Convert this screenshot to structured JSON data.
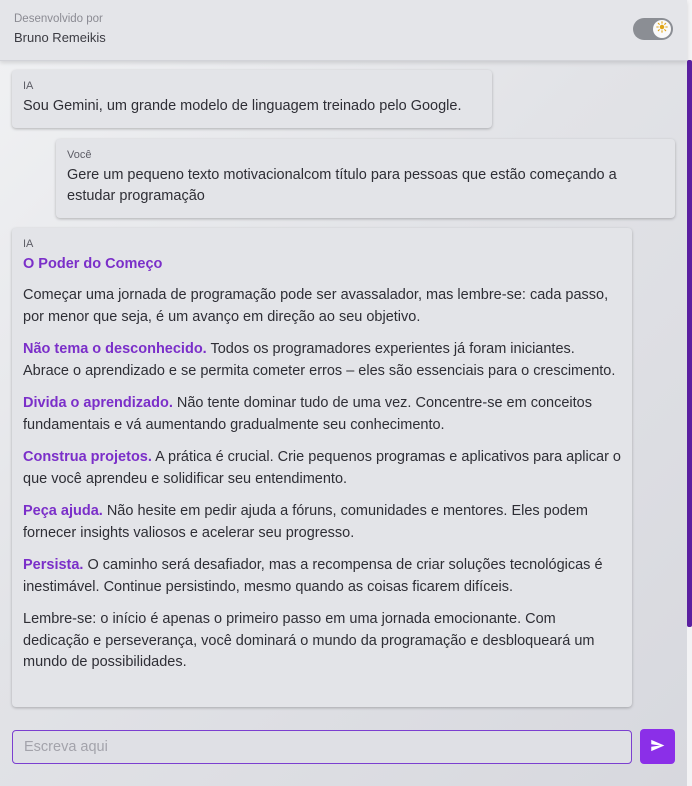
{
  "header": {
    "caption": "Desenvolvido por",
    "author": "Bruno Remeikis",
    "theme_toggle_icon": "sun-icon"
  },
  "messages": [
    {
      "sender": "IA",
      "text": "Sou Gemini, um grande modelo de linguagem treinado pelo Google."
    },
    {
      "sender": "Você",
      "text": "Gere um pequeno texto motivacionalcom título para pessoas que estão começando a estudar programação"
    },
    {
      "sender": "IA",
      "title": "O Poder do Começo",
      "paragraphs": [
        {
          "highlight": "",
          "text": "Começar uma jornada de programação pode ser avassalador, mas lembre-se: cada passo, por menor que seja, é um avanço em direção ao seu objetivo."
        },
        {
          "highlight": "Não tema o desconhecido.",
          "text": " Todos os programadores experientes já foram iniciantes. Abrace o aprendizado e se permita cometer erros – eles são essenciais para o crescimento."
        },
        {
          "highlight": "Divida o aprendizado.",
          "text": " Não tente dominar tudo de uma vez. Concentre-se em conceitos fundamentais e vá aumentando gradualmente seu conhecimento."
        },
        {
          "highlight": "Construa projetos.",
          "text": " A prática é crucial. Crie pequenos programas e aplicativos para aplicar o que você aprendeu e solidificar seu entendimento."
        },
        {
          "highlight": "Peça ajuda.",
          "text": " Não hesite em pedir ajuda a fóruns, comunidades e mentores. Eles podem fornecer insights valiosos e acelerar seu progresso."
        },
        {
          "highlight": "Persista.",
          "text": " O caminho será desafiador, mas a recompensa de criar soluções tecnológicas é inestimável. Continue persistindo, mesmo quando as coisas ficarem difíceis."
        },
        {
          "highlight": "",
          "text": "Lembre-se: o início é apenas o primeiro passo em uma jornada emocionante. Com dedicação e perseverança, você dominará o mundo da programação e desbloqueará um mundo de possibilidades."
        }
      ]
    }
  ],
  "composer": {
    "placeholder": "Escreva aqui",
    "value": "",
    "send_icon": "send-icon"
  },
  "colors": {
    "accent": "#7b2fc9",
    "send_button": "#8b2fe8",
    "scrollbar": "#5a1fa0"
  }
}
